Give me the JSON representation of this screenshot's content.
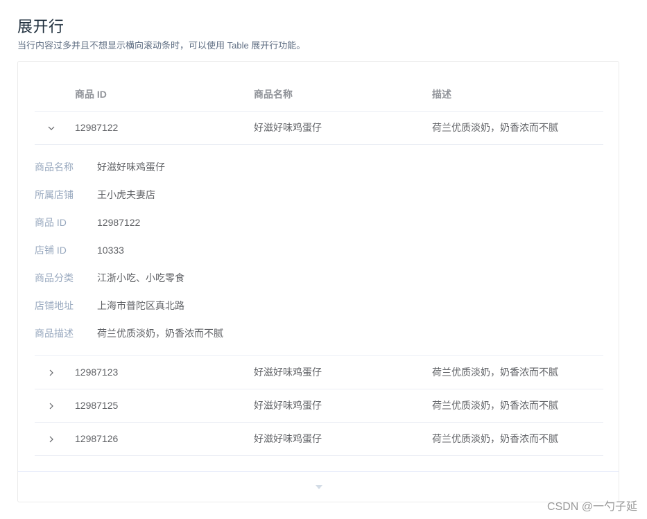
{
  "page": {
    "title": "展开行",
    "description": "当行内容过多并且不想显示横向滚动条时，可以使用 Table 展开行功能。"
  },
  "table": {
    "columns": [
      "商品 ID",
      "商品名称",
      "描述"
    ],
    "rows": [
      {
        "id": "12987122",
        "name": "好滋好味鸡蛋仔",
        "desc": "荷兰优质淡奶，奶香浓而不腻",
        "expanded": true
      },
      {
        "id": "12987123",
        "name": "好滋好味鸡蛋仔",
        "desc": "荷兰优质淡奶，奶香浓而不腻",
        "expanded": false
      },
      {
        "id": "12987125",
        "name": "好滋好味鸡蛋仔",
        "desc": "荷兰优质淡奶，奶香浓而不腻",
        "expanded": false
      },
      {
        "id": "12987126",
        "name": "好滋好味鸡蛋仔",
        "desc": "荷兰优质淡奶，奶香浓而不腻",
        "expanded": false
      }
    ],
    "detail": [
      {
        "label": "商品名称",
        "value": "好滋好味鸡蛋仔"
      },
      {
        "label": "所属店铺",
        "value": "王小虎夫妻店"
      },
      {
        "label": "商品 ID",
        "value": "12987122"
      },
      {
        "label": "店铺 ID",
        "value": "10333"
      },
      {
        "label": "商品分类",
        "value": "江浙小吃、小吃零食"
      },
      {
        "label": "店铺地址",
        "value": "上海市普陀区真北路"
      },
      {
        "label": "商品描述",
        "value": "荷兰优质淡奶，奶香浓而不腻"
      }
    ]
  },
  "watermark": "CSDN @一勺子延",
  "colors": {
    "label": "#99a9bf",
    "text": "#606266",
    "header": "#909399",
    "border": "#ebeef5"
  }
}
